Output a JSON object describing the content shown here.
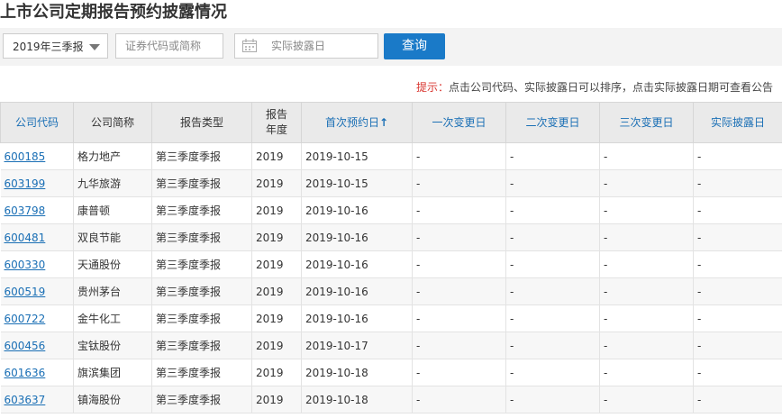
{
  "page_title": "上市公司定期报告预约披露情况",
  "filters": {
    "period_select": "2019年三季报",
    "code_placeholder": "证券代码或简称",
    "date_placeholder": "实际披露日",
    "query_button": "查询"
  },
  "hint": {
    "label": "提示：",
    "text": "点击公司代码、实际披露日可以排序，点击实际披露日期可查看公告"
  },
  "table": {
    "headers": {
      "code": "公司代码",
      "name": "公司简称",
      "type": "报告类型",
      "year": "报告年度",
      "first": "首次预约日",
      "sort_arrow": "↑",
      "change1": "一次变更日",
      "change2": "二次变更日",
      "change3": "三次变更日",
      "actual": "实际披露日"
    },
    "rows": [
      {
        "code": "600185",
        "name": "格力地产",
        "type": "第三季度季报",
        "year": "2019",
        "first": "2019-10-15",
        "c1": "-",
        "c2": "-",
        "c3": "-",
        "actual": "-"
      },
      {
        "code": "603199",
        "name": "九华旅游",
        "type": "第三季度季报",
        "year": "2019",
        "first": "2019-10-15",
        "c1": "-",
        "c2": "-",
        "c3": "-",
        "actual": "-"
      },
      {
        "code": "603798",
        "name": "康普顿",
        "type": "第三季度季报",
        "year": "2019",
        "first": "2019-10-16",
        "c1": "-",
        "c2": "-",
        "c3": "-",
        "actual": "-"
      },
      {
        "code": "600481",
        "name": "双良节能",
        "type": "第三季度季报",
        "year": "2019",
        "first": "2019-10-16",
        "c1": "-",
        "c2": "-",
        "c3": "-",
        "actual": "-"
      },
      {
        "code": "600330",
        "name": "天通股份",
        "type": "第三季度季报",
        "year": "2019",
        "first": "2019-10-16",
        "c1": "-",
        "c2": "-",
        "c3": "-",
        "actual": "-"
      },
      {
        "code": "600519",
        "name": "贵州茅台",
        "type": "第三季度季报",
        "year": "2019",
        "first": "2019-10-16",
        "c1": "-",
        "c2": "-",
        "c3": "-",
        "actual": "-"
      },
      {
        "code": "600722",
        "name": "金牛化工",
        "type": "第三季度季报",
        "year": "2019",
        "first": "2019-10-16",
        "c1": "-",
        "c2": "-",
        "c3": "-",
        "actual": "-"
      },
      {
        "code": "600456",
        "name": "宝钛股份",
        "type": "第三季度季报",
        "year": "2019",
        "first": "2019-10-17",
        "c1": "-",
        "c2": "-",
        "c3": "-",
        "actual": "-"
      },
      {
        "code": "601636",
        "name": "旗滨集团",
        "type": "第三季度季报",
        "year": "2019",
        "first": "2019-10-18",
        "c1": "-",
        "c2": "-",
        "c3": "-",
        "actual": "-"
      },
      {
        "code": "603637",
        "name": "镇海股份",
        "type": "第三季度季报",
        "year": "2019",
        "first": "2019-10-18",
        "c1": "-",
        "c2": "-",
        "c3": "-",
        "actual": "-"
      }
    ]
  }
}
